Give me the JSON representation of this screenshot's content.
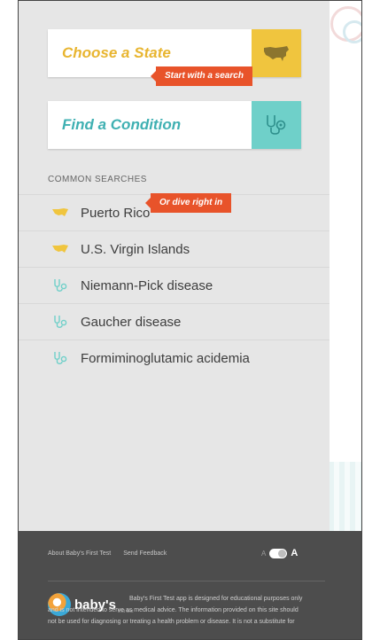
{
  "panel": {
    "state_search": {
      "label": "Choose a State",
      "icon": "us-map-icon"
    },
    "condition_search": {
      "label": "Find a Condition",
      "icon": "stethoscope-icon"
    },
    "callouts": [
      "Start with a search",
      "Or dive right in"
    ],
    "common_searches_title": "COMMON SEARCHES",
    "common_searches": [
      {
        "label": "Puerto Rico",
        "icon": "state-map-icon"
      },
      {
        "label": "U.S. Virgin Islands",
        "icon": "state-map-icon"
      },
      {
        "label": "Niemann-Pick disease",
        "icon": "stethoscope-icon"
      },
      {
        "label": "Gaucher disease",
        "icon": "stethoscope-icon"
      },
      {
        "label": "Formiminoglutamic acidemia",
        "icon": "stethoscope-icon"
      }
    ]
  },
  "footer": {
    "links": [
      "About Baby's First Test",
      "Send Feedback"
    ],
    "text_size_small": "A",
    "text_size_large": "A",
    "logo_text": "baby's",
    "logo_sub": "first test",
    "disclaimer": "Baby's First Test app is designed for educational purposes only and is not intended to serve as medical advice. The information provided on this site should not be used for diagnosing or treating a health problem or disease. It is not a substitute for"
  },
  "colors": {
    "state_accent": "#f0c53e",
    "condition_accent": "#6fd0c9",
    "callout": "#e8532a",
    "footer_bg": "#4d4d4d"
  }
}
